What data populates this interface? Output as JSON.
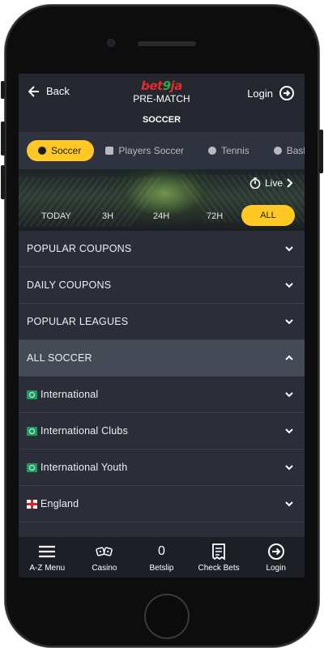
{
  "header": {
    "back_label": "Back",
    "logo": {
      "bet": "bet",
      "nine": "9",
      "ja": "ja"
    },
    "subtitle": "PRE-MATCH",
    "sport_title": "SOCCER",
    "login_label": "Login"
  },
  "tabs": [
    {
      "label": "Soccer",
      "active": true
    },
    {
      "label": "Players Soccer",
      "active": false
    },
    {
      "label": "Tennis",
      "active": false
    },
    {
      "label": "Baske",
      "active": false
    }
  ],
  "banner": {
    "live_label": "Live",
    "time_filters": [
      "TODAY",
      "3H",
      "24H",
      "72H",
      "ALL"
    ],
    "selected_filter": "ALL"
  },
  "list": {
    "sections": [
      {
        "label": "POPULAR COUPONS",
        "expanded": false
      },
      {
        "label": "DAILY COUPONS",
        "expanded": false
      },
      {
        "label": "POPULAR LEAGUES",
        "expanded": false
      },
      {
        "label": "ALL SOCCER",
        "expanded": true
      }
    ],
    "countries": [
      {
        "label": "International",
        "flag": "world-flag-icon"
      },
      {
        "label": "International Clubs",
        "flag": "world-flag-icon"
      },
      {
        "label": "International Youth",
        "flag": "world-flag-icon"
      },
      {
        "label": "England",
        "flag": "england-flag-icon"
      }
    ]
  },
  "bottom_nav": {
    "menu": "A-Z Menu",
    "casino": "Casino",
    "betslip_count": "0",
    "betslip": "Betslip",
    "check_bets": "Check Bets",
    "login": "Login"
  },
  "colors": {
    "accent": "#ffc824",
    "background": "#2b2e38",
    "header": "#24272f",
    "nav": "#1d1f26"
  }
}
